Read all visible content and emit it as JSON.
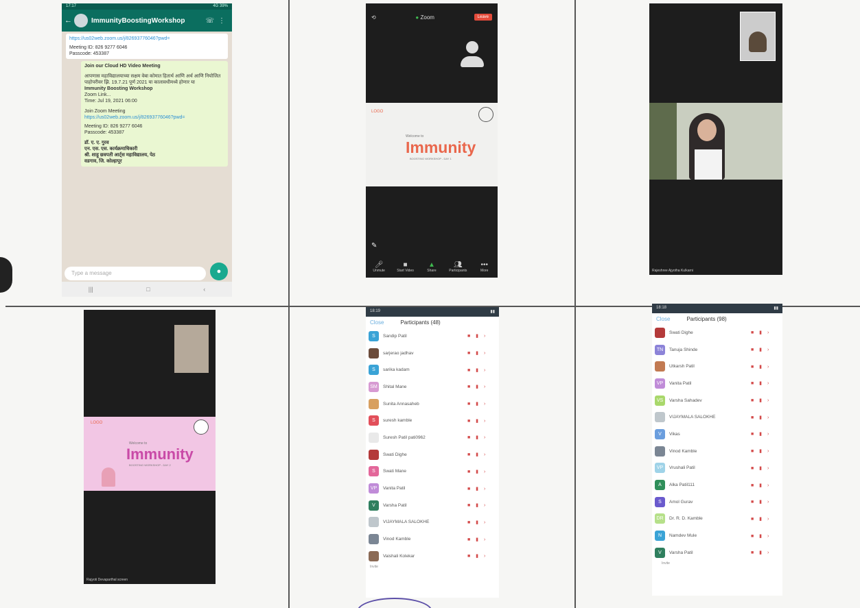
{
  "whatsapp": {
    "status_time": "17:17",
    "status_right": "4G 39%",
    "group_title": "ImmunityBoostingWorkshop",
    "group_subtitle": "",
    "link_top": "https://us02web.zoom.us/j/82693776046?pwd=",
    "meeting_id_line": "Meeting ID: 826 9277 6046",
    "passcode_line": "Passcode: 453387",
    "invite_title": "Join our Cloud HD Video Meeting",
    "invite_body_marathi": "आपणास महाविद्यालयाच्या सक्षम वेबा कोमात हितार्थ आणि अर्थ आणि नियोजित पाहोपरीवर झि. 19.7.21 पूर्ण 2021 या कालावधीमध्ये होणार या",
    "invite_bold": "Immunity Boosting Workshop",
    "zoom_link_label": "Zoom Link...",
    "time_line": "Time: Jul 19, 2021 06:00",
    "join_label": "Join Zoom Meeting",
    "link_bottom": "https://us02web.zoom.us/j/82693776046?pwd=",
    "meeting_id_line2": "Meeting ID: 826 9277 6046",
    "passcode_line2": "Passcode: 453387",
    "signature_1": "डॉ. ए. ए. गुरव",
    "signature_2": "एन. एस. एस. कार्यक्रमाधिकारी",
    "signature_3": "श्री. शाहू छत्रपती आर्ट्स महाविद्यालय, पेठ",
    "signature_4": "वडगाव, जि. कोल्हापूर",
    "input_placeholder": "Type a message",
    "mic_icon": "microphone-icon"
  },
  "zoom1": {
    "app_label": "Zoom",
    "leave_label": "Leave",
    "slide_welcome": "Welcome to",
    "slide_title": "Immunity",
    "slide_subtitle": "BOOSTING WORKSHOP - DAY 1",
    "toolbar": [
      "Unmute",
      "Start Video",
      "Share",
      "Participants",
      "More"
    ]
  },
  "zoom2": {
    "speaker_caption": "Rajeshree Ajyotha Kulkarni"
  },
  "zoom3": {
    "slide_welcome": "Welcome to",
    "slide_title": "Immunity",
    "slide_subtitle": "BOOSTING WORKSHOP - DAY 2",
    "speaker_caption": "Rajyoti Devaparthal screen"
  },
  "participants1": {
    "time": "18:19",
    "close_label": "Close",
    "title": "Participants (48)",
    "rows": [
      {
        "name": "Sandip Patil",
        "initial": "S",
        "color": "#3aa3d6"
      },
      {
        "name": "sarjerao jadhav",
        "initial": "",
        "color": "#6b4b3a"
      },
      {
        "name": "sarika kadam",
        "initial": "S",
        "color": "#3aa3d6"
      },
      {
        "name": "Shital Mane",
        "initial": "SM",
        "color": "#d79ad2"
      },
      {
        "name": "Sunita Annasaheb",
        "initial": "",
        "color": "#d8a060"
      },
      {
        "name": "suresh kamble",
        "initial": "S",
        "color": "#e24f5a"
      },
      {
        "name": "Suresh Patil pati0962",
        "initial": "",
        "color": "#e9e9e9"
      },
      {
        "name": "Swati Dighe",
        "initial": "",
        "color": "#b43a3a"
      },
      {
        "name": "Swati Mane",
        "initial": "S",
        "color": "#e3679a"
      },
      {
        "name": "Vanita Patil",
        "initial": "VP",
        "color": "#c08cd8"
      },
      {
        "name": "Varsha Patil",
        "initial": "V",
        "color": "#2f7f5e"
      },
      {
        "name": "VIJAYMALA SALOKHE",
        "initial": "",
        "color": "#bfc7cc"
      },
      {
        "name": "Vinod Kamble",
        "initial": "",
        "color": "#7b8694"
      },
      {
        "name": "Vaishali Kolekar",
        "initial": "",
        "color": "#8b6a55"
      }
    ],
    "invite_label": "Invite"
  },
  "participants2": {
    "time": "18:18",
    "close_label": "Close",
    "title": "Participants (98)",
    "rows": [
      {
        "name": "Swati Dighe",
        "initial": "",
        "color": "#b43a3a"
      },
      {
        "name": "Tanuja Shinde",
        "initial": "TN",
        "color": "#8c83d8"
      },
      {
        "name": "Utkarsh Patil",
        "initial": "",
        "color": "#c27a52"
      },
      {
        "name": "Vanita Patil",
        "initial": "VP",
        "color": "#c08cd8"
      },
      {
        "name": "Varsha Sahadev",
        "initial": "VS",
        "color": "#a9d86b"
      },
      {
        "name": "VIJAYMALA SALOKHE",
        "initial": "",
        "color": "#bfc7cc"
      },
      {
        "name": "Vikas",
        "initial": "V",
        "color": "#6b9ede"
      },
      {
        "name": "Vinod Kamble",
        "initial": "",
        "color": "#7b8694"
      },
      {
        "name": "Vrushali Patil",
        "initial": "VP",
        "color": "#9fd3e8"
      },
      {
        "name": "Alka Patil111",
        "initial": "A",
        "color": "#2f8f5a"
      },
      {
        "name": "Amol Gurav",
        "initial": "S",
        "color": "#6a5acd"
      },
      {
        "name": "Dr. R. D. Kamble",
        "initial": "DR",
        "color": "#b6e08a"
      },
      {
        "name": "Namdev Mule",
        "initial": "N",
        "color": "#3aa3d6"
      },
      {
        "name": "Varsha Patil",
        "initial": "V",
        "color": "#2f7f5e"
      }
    ],
    "invite_label": "Invite"
  }
}
